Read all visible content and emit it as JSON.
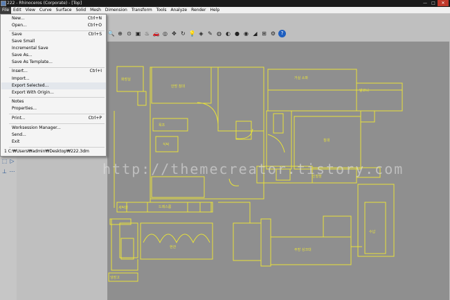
{
  "window": {
    "title": "222 - Rhinoceros (Corporate) - [Top]",
    "buttons": [
      "—",
      "□",
      "✕"
    ]
  },
  "menubar": {
    "items": [
      "File",
      "Edit",
      "View",
      "Curve",
      "Surface",
      "Solid",
      "Mesh",
      "Dimension",
      "Transform",
      "Tools",
      "Analyze",
      "Render",
      "Help"
    ],
    "active": "File"
  },
  "file_menu": {
    "new": {
      "label": "New...",
      "shortcut": "Ctrl+N"
    },
    "open": {
      "label": "Open...",
      "shortcut": "Ctrl+O"
    },
    "save": {
      "label": "Save",
      "shortcut": "Ctrl+S"
    },
    "save_small": {
      "label": "Save Small"
    },
    "incremental_save": {
      "label": "Incremental Save"
    },
    "save_as": {
      "label": "Save As..."
    },
    "save_as_template": {
      "label": "Save As Template..."
    },
    "insert": {
      "label": "Insert...",
      "shortcut": "Ctrl+I"
    },
    "import": {
      "label": "Import..."
    },
    "export_selected": {
      "label": "Export Selected..."
    },
    "export_with_origin": {
      "label": "Export With Origin..."
    },
    "notes": {
      "label": "Notes"
    },
    "properties": {
      "label": "Properties..."
    },
    "print": {
      "label": "Print...",
      "shortcut": "Ctrl+P"
    },
    "worksession_manager": {
      "label": "Worksession Manager..."
    },
    "send": {
      "label": "Send..."
    },
    "exit": {
      "label": "Exit"
    },
    "recent_1": {
      "label": "1 C:₩Users₩admin₩Desktop₩222.3dm"
    }
  },
  "toolbar": {
    "icons": [
      "zoom-icon",
      "zoom-window-icon",
      "zoom-extents-icon",
      "zoom-selected-icon",
      "render-icon",
      "car-icon",
      "camera-icon",
      "pan-icon",
      "rotate-icon",
      "bulb-icon",
      "mesh-icon",
      "edit-icon",
      "color-icon",
      "material-icon",
      "sphere-icon",
      "shade-icon",
      "pin-icon",
      "grid-icon",
      "settings-icon",
      "help-icon"
    ],
    "glyphs": [
      "🔍",
      "⊕",
      "⊙",
      "▣",
      "♨",
      "🚗",
      "◎",
      "✥",
      "↻",
      "💡",
      "◈",
      "✎",
      "◍",
      "◐",
      "●",
      "◉",
      "◢",
      "⊞",
      "⚙",
      "?"
    ]
  },
  "watermark": "http://themecreator.tistory.com",
  "floorplan_labels": {
    "room_1": "화장실",
    "room_2": "안방 침대",
    "room_3": "거실 소파",
    "room_4": "욕조",
    "room_5": "발코니",
    "room_6": "침대",
    "room_7": "식탁",
    "room_8": "신발장",
    "room_9": "주방 싱크대",
    "room_10": "현관",
    "room_11": "드레스룸",
    "room_12": "냉장고",
    "room_13": "세탁실",
    "room_14": "수납"
  },
  "colors": {
    "viewport_bg": "#8f8f8f",
    "wall_lines": "#e8e23a",
    "menu_active": "#3b3b3b",
    "highlight": "#e3e7ec"
  }
}
